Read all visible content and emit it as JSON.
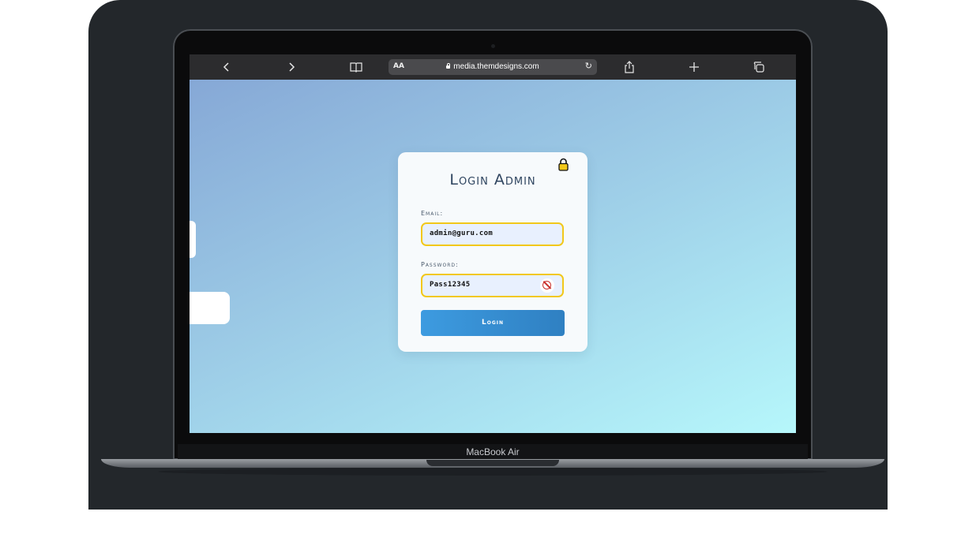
{
  "browser": {
    "text_size_label": "AA",
    "url": "media.themdesigns.com",
    "icons": {
      "back": "chevron-left",
      "forward": "chevron-right",
      "bookmarks": "book",
      "reload": "reload",
      "share": "share",
      "new_tab": "plus",
      "tabs": "tabs"
    }
  },
  "login": {
    "title": "Login Admin",
    "email_label": "Email:",
    "email_value": "admin@guru.com",
    "password_label": "Password:",
    "password_value": "Pass12345",
    "button_label": "Login",
    "accent_border_color": "#f2c81a",
    "button_color": "#3390d6"
  },
  "device": {
    "model_label": "MacBook Air"
  }
}
